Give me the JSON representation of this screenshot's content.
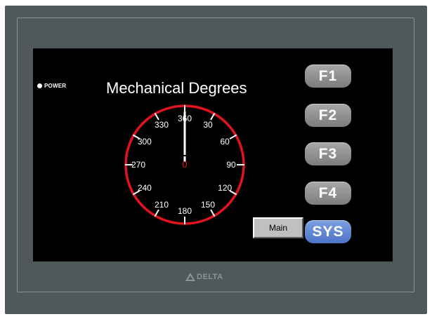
{
  "hmi": {
    "power_label": "POWER",
    "title": "Mechanical Degrees",
    "main_button": "Main",
    "brand": "DELTA",
    "function_keys": [
      {
        "label": "F1"
      },
      {
        "label": "F2"
      },
      {
        "label": "F3"
      },
      {
        "label": "F4"
      },
      {
        "label": "SYS"
      }
    ]
  },
  "dial": {
    "value": "0",
    "value_degrees": 0,
    "tick_labels": [
      "360",
      "30",
      "60",
      "90",
      "120",
      "150",
      "180",
      "210",
      "240",
      "270",
      "300",
      "330"
    ],
    "ring_color": "#e0141e",
    "value_color": "#e0141e",
    "needle_color": "#ffffff"
  },
  "colors": {
    "bezel": "#50585c",
    "screen": "#000000",
    "fkey": "#8c8c8c",
    "sys_key": "#5b80cf"
  }
}
